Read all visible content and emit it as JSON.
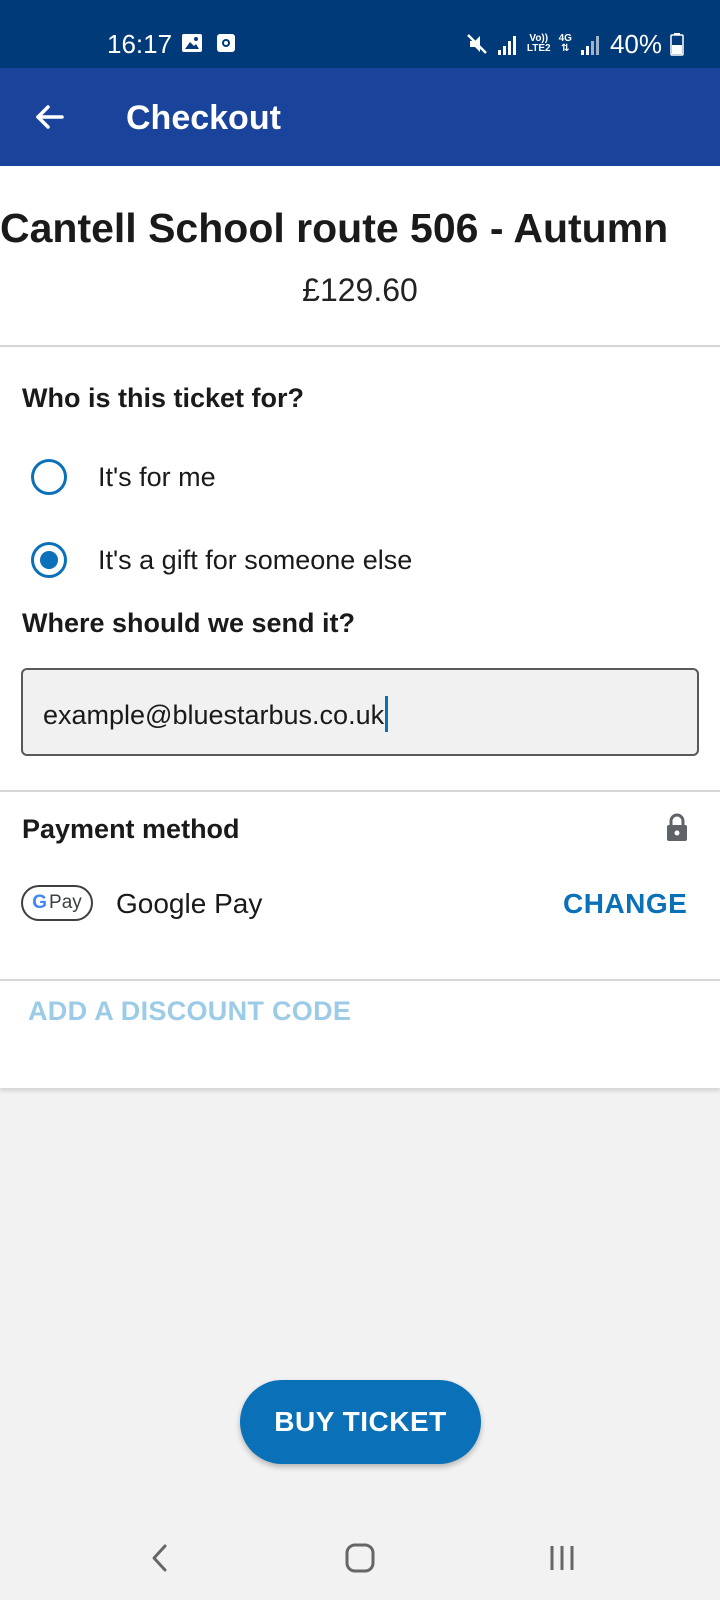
{
  "status_bar": {
    "time": "16:17",
    "battery": "40%",
    "network_label_top": "Vo))",
    "network_label_bottom": "LTE2",
    "network_4g": "4G",
    "icons": [
      "gallery-icon",
      "screen-record-icon",
      "mute-icon",
      "signal-icon",
      "signal-icon-2",
      "battery-icon"
    ]
  },
  "app_bar": {
    "title": "Checkout",
    "back_icon": "arrow-left-icon"
  },
  "ticket": {
    "title": "Cantell School route 506 - Autumn",
    "price": "£129.60"
  },
  "recipient": {
    "question": "Who is this ticket for?",
    "options": [
      {
        "label": "It's for me",
        "selected": false
      },
      {
        "label": "It's a gift for someone else",
        "selected": true
      }
    ]
  },
  "send_to": {
    "question": "Where should we send it?",
    "email_value": "example@bluestarbus.co.uk"
  },
  "payment": {
    "label": "Payment method",
    "badge_g": "G",
    "badge_text": "Pay",
    "method_name": "Google Pay",
    "change_label": "CHANGE"
  },
  "discount": {
    "label": "ADD A DISCOUNT CODE"
  },
  "buy_button": {
    "label": "BUY TICKET"
  },
  "colors": {
    "status_bar": "#003a78",
    "app_bar": "#1a439b",
    "accent": "#0a70b8",
    "disabled_link": "#9ccbe7",
    "background": "#f2f2f2"
  }
}
